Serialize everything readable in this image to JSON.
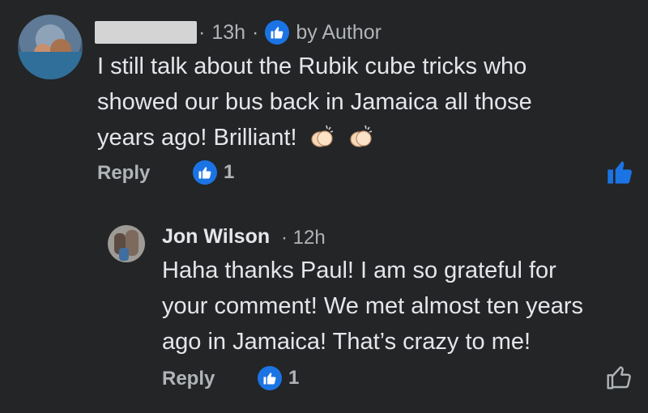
{
  "comment": {
    "time": "13h",
    "author_badge": "by Author",
    "text_lines": [
      "I still talk about the Rubik cube tricks who",
      "showed our bus back in Jamaica all those",
      "years ago! Brilliant!"
    ],
    "reply_label": "Reply",
    "reaction_count": "1"
  },
  "reply": {
    "name": "Jon Wilson",
    "time": "12h",
    "text_lines": [
      "Haha thanks Paul! I am so grateful for",
      "your comment! We met almost ten years",
      "ago in Jamaica! That’s crazy to me!"
    ],
    "reply_label": "Reply",
    "reaction_count": "1"
  },
  "colors": {
    "background": "#242526",
    "accent": "#1b74e4",
    "text": "#e4e6eb",
    "muted": "#b0b3b8"
  },
  "icons": {
    "author_badge": "thumbs-up-icon",
    "emoji": "clapping-hands-icon",
    "liked": "thumbs-up-filled-icon",
    "unliked": "thumbs-up-outline-icon"
  }
}
